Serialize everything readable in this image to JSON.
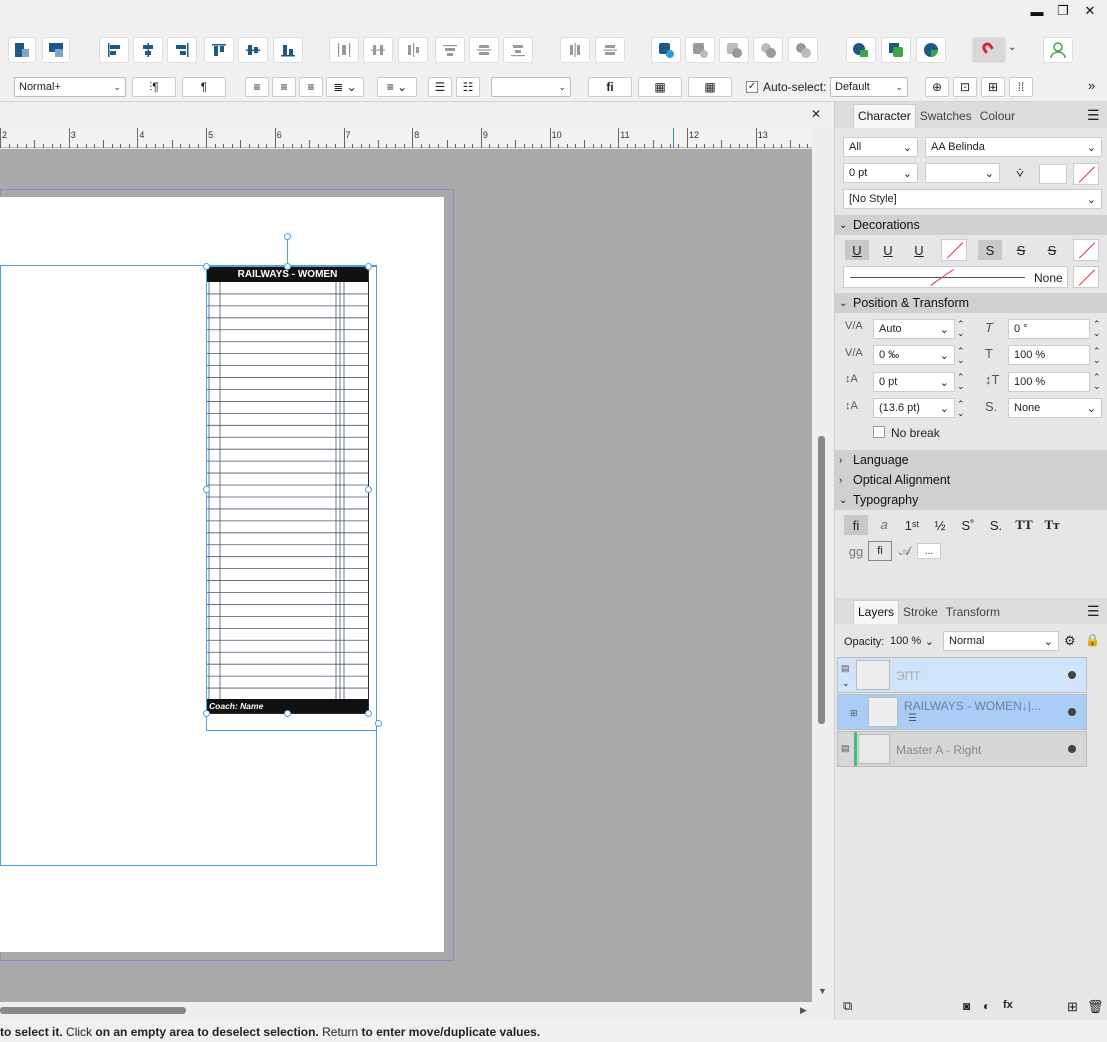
{
  "window": {
    "minimize": "▬",
    "restore": "❐",
    "close": "✕"
  },
  "toolbar2": {
    "paragraph_style": "Normal+",
    "pilcrow": "¶",
    "ligature_label": "fi",
    "auto_select_label": "Auto-select:",
    "auto_select_value": "Default",
    "overflow": "»"
  },
  "document": {
    "close": "✕"
  },
  "ruler": {
    "ticks": [
      "2",
      "3",
      "4",
      "5",
      "6",
      "7",
      "8",
      "9",
      "10",
      "11",
      "12",
      "13"
    ]
  },
  "frame": {
    "header": "RAILWAYS - WOMEN",
    "footer": "Coach: Name",
    "rows": 35
  },
  "panel_top": {
    "tabs": [
      "Character",
      "Swatches",
      "Colour"
    ],
    "active_tab": "Character",
    "language_scope": "All",
    "font_family": "AA Belinda",
    "font_size": "0 pt",
    "char_style": "[No Style]",
    "sections": {
      "decorations": "Decorations",
      "position": "Position & Transform",
      "language": "Language",
      "optical": "Optical Alignment",
      "typography": "Typography"
    },
    "decor_line_none": "None",
    "position": {
      "kerning": "Auto",
      "skew": "0 °",
      "tracking": "0 ‰",
      "vscale": "100 %",
      "baseline": "0 pt",
      "hscale": "100 %",
      "leading": "(13.6 pt)",
      "position_value": "None",
      "no_break": "No break"
    },
    "typography_buttons": [
      "fi",
      "𝑎",
      "1ˢᵗ",
      "½",
      "S˚",
      "S.",
      "TT",
      "Tт",
      "gg",
      "fi",
      "𝒜",
      "..."
    ]
  },
  "layers_panel": {
    "tabs": [
      "Layers",
      "Stroke",
      "Transform"
    ],
    "active_tab": "Layers",
    "opacity_label": "Opacity:",
    "opacity_value": "100 %",
    "blend_mode": "Normal",
    "layers": [
      {
        "name": "ЭПТ",
        "selected": true
      },
      {
        "name": "RAILWAYS - WOMEN↓|...",
        "selected": true
      },
      {
        "name": "Master A - Right",
        "selected": false
      }
    ]
  },
  "status": {
    "t1": "to select it.",
    "t2": " Click ",
    "t3": "on an empty area to deselect selection.",
    "t4": " Return ",
    "t5": "to enter move/duplicate values."
  },
  "colors": {
    "accent": "#1e8be0",
    "selection": "#cce4fb",
    "master_bar": "#3cbf7a"
  }
}
